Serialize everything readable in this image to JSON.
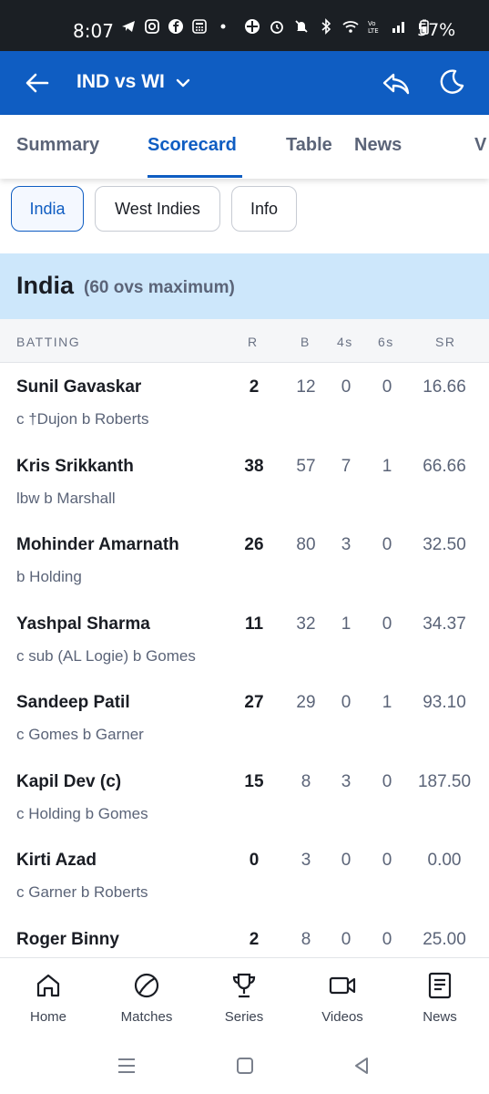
{
  "status_bar": {
    "time": "8:07",
    "battery": "57%"
  },
  "app_bar": {
    "title": "IND vs WI"
  },
  "tabs": [
    "Summary",
    "Scorecard",
    "Table",
    "News",
    "V"
  ],
  "active_tab": "Scorecard",
  "chips": [
    "India",
    "West Indies",
    "Info"
  ],
  "active_chip": "India",
  "innings": {
    "team": "India",
    "subtitle": "(60 ovs maximum)",
    "columns": [
      "BATTING",
      "R",
      "B",
      "4s",
      "6s",
      "SR"
    ],
    "batters": [
      {
        "name": "Sunil Gavaskar",
        "dismissal": "c †Dujon b Roberts",
        "r": "2",
        "b": "12",
        "fours": "0",
        "sixes": "0",
        "sr": "16.66"
      },
      {
        "name": "Kris Srikkanth",
        "dismissal": "lbw b Marshall",
        "r": "38",
        "b": "57",
        "fours": "7",
        "sixes": "1",
        "sr": "66.66"
      },
      {
        "name": "Mohinder Amarnath",
        "dismissal": "b Holding",
        "r": "26",
        "b": "80",
        "fours": "3",
        "sixes": "0",
        "sr": "32.50"
      },
      {
        "name": "Yashpal Sharma",
        "dismissal": "c sub (AL Logie) b Gomes",
        "r": "11",
        "b": "32",
        "fours": "1",
        "sixes": "0",
        "sr": "34.37"
      },
      {
        "name": "Sandeep Patil",
        "dismissal": "c Gomes b Garner",
        "r": "27",
        "b": "29",
        "fours": "0",
        "sixes": "1",
        "sr": "93.10"
      },
      {
        "name": "Kapil Dev (c)",
        "dismissal": "c Holding b Gomes",
        "r": "15",
        "b": "8",
        "fours": "3",
        "sixes": "0",
        "sr": "187.50"
      },
      {
        "name": "Kirti Azad",
        "dismissal": "c Garner b Roberts",
        "r": "0",
        "b": "3",
        "fours": "0",
        "sixes": "0",
        "sr": "0.00"
      },
      {
        "name": "Roger Binny",
        "dismissal": "",
        "r": "2",
        "b": "8",
        "fours": "0",
        "sixes": "0",
        "sr": "25.00"
      }
    ]
  },
  "bottom_nav": [
    {
      "label": "Home",
      "icon": "home-icon"
    },
    {
      "label": "Matches",
      "icon": "ball-icon"
    },
    {
      "label": "Series",
      "icon": "trophy-icon"
    },
    {
      "label": "Videos",
      "icon": "video-icon"
    },
    {
      "label": "News",
      "icon": "news-icon"
    }
  ],
  "colors": {
    "primary": "#0f5dc2",
    "team_header_bg": "#cde7fb",
    "status_bar_bg": "#1b1f24"
  }
}
